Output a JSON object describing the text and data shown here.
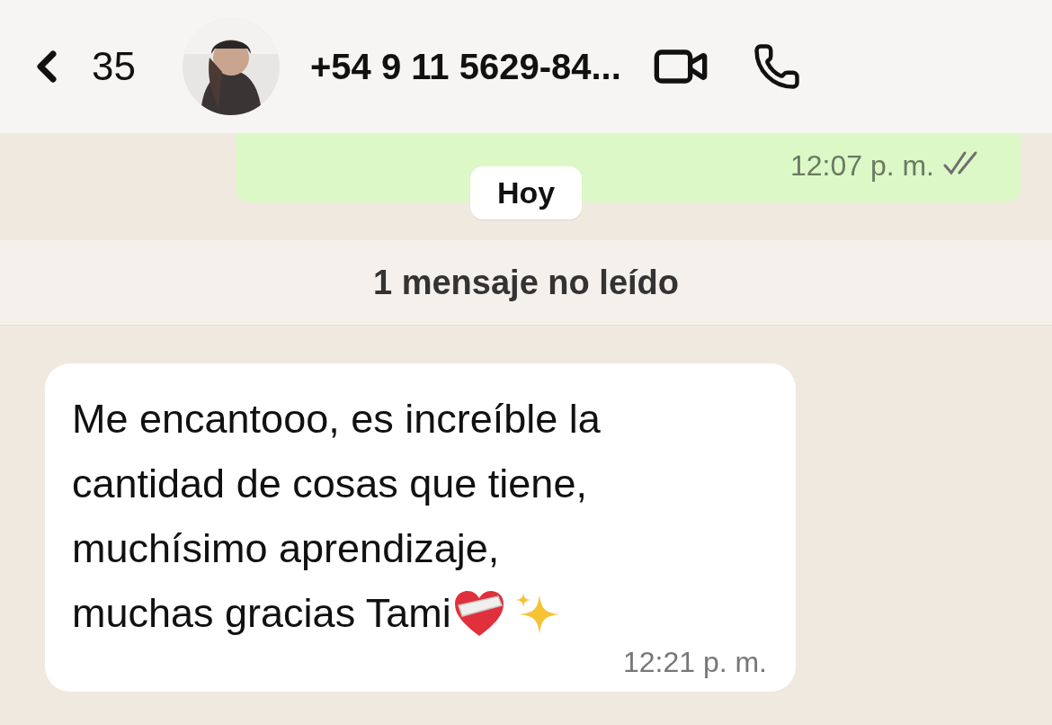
{
  "header": {
    "back_count": "35",
    "title": "+54 9 11 5629-84..."
  },
  "sent": {
    "time": "12:07 p. m.",
    "read": false
  },
  "date_chip": "Hoy",
  "unread_banner": "1 mensaje no leído",
  "received": {
    "lines": [
      "Me encantooo, es increíble la",
      "cantidad de cosas que tiene,",
      "muchísimo aprendizaje,",
      "muchas gracias Tami"
    ],
    "time": "12:21 p. m."
  }
}
